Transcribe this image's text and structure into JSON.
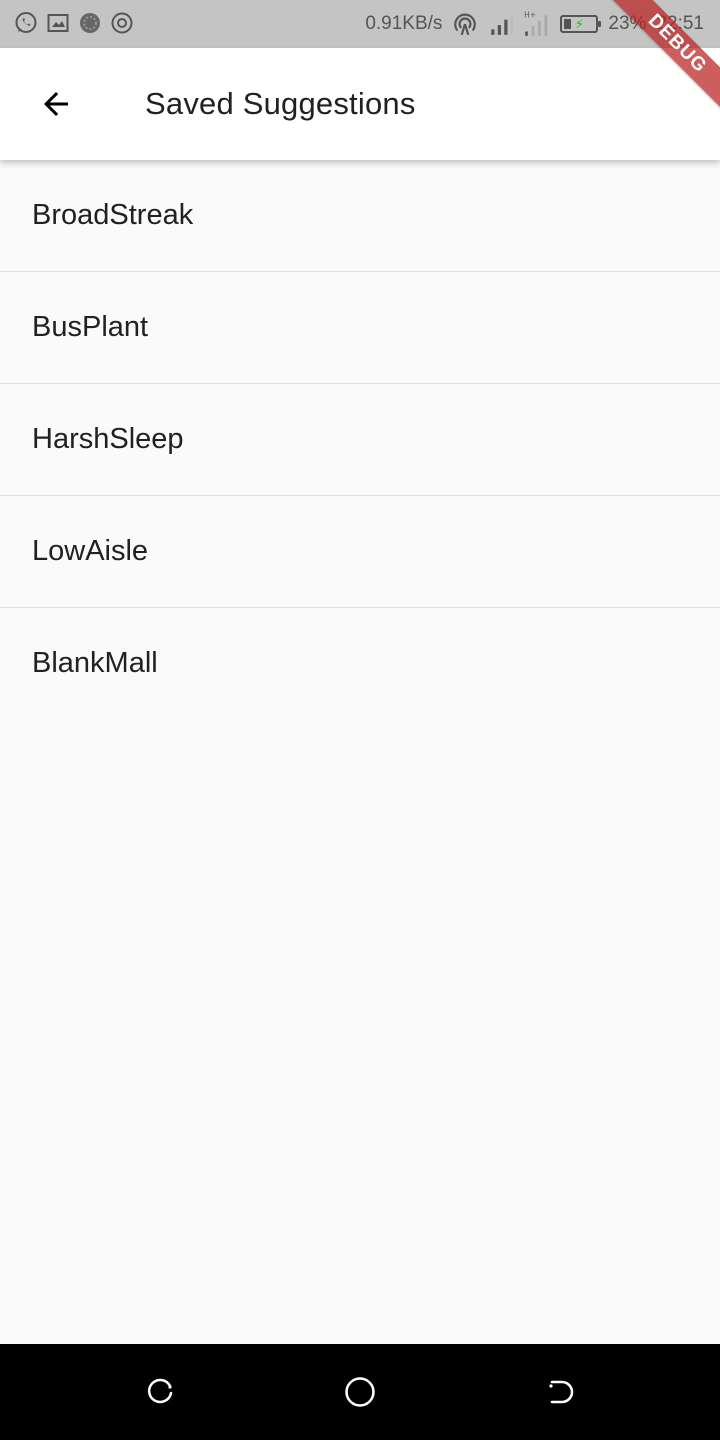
{
  "status_bar": {
    "network_speed": "0.91KB/s",
    "battery_percent": "23%",
    "time": "22:51",
    "battery_level": 0.23,
    "left_icons": [
      "whatsapp-icon",
      "screenshot-icon",
      "sync-icon",
      "record-icon"
    ]
  },
  "app_bar": {
    "title": "Saved Suggestions",
    "back_icon": "arrow-back-icon"
  },
  "debug_banner": "DEBUG",
  "suggestions": [
    {
      "label": "BroadStreak"
    },
    {
      "label": "BusPlant"
    },
    {
      "label": "HarshSleep"
    },
    {
      "label": "LowAisle"
    },
    {
      "label": "BlankMall"
    }
  ],
  "nav_bar": {
    "icons": [
      "recents-icon",
      "home-icon",
      "back-icon"
    ]
  },
  "colors": {
    "status_bar_bg": "#c4c4c4",
    "app_bar_bg": "#ffffff",
    "body_bg": "#fafafa",
    "debug_banner": "#b92020",
    "nav_bar_bg": "#000000"
  }
}
